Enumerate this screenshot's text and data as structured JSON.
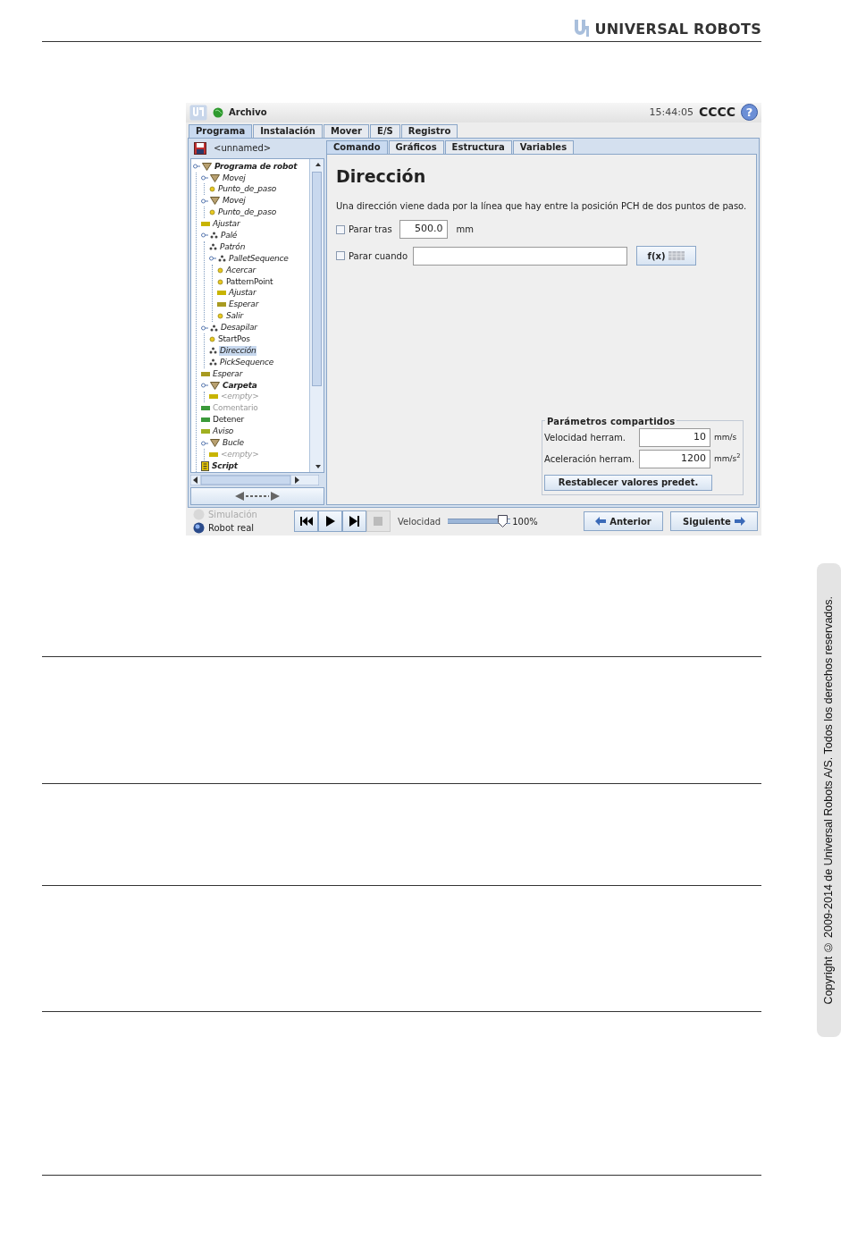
{
  "header": {
    "brand": "UNIVERSAL ROBOTS"
  },
  "app": {
    "title_bar": {
      "menu": "Archivo",
      "time": "15:44:05",
      "user": "CCCC",
      "help": "?"
    },
    "tabs": [
      {
        "label": "Programa",
        "selected": true
      },
      {
        "label": "Instalación",
        "selected": false
      },
      {
        "label": "Mover",
        "selected": false
      },
      {
        "label": "E/S",
        "selected": false
      },
      {
        "label": "Registro",
        "selected": false
      }
    ],
    "program_name": "<unnamed>",
    "tree": [
      {
        "label": "Programa de robot",
        "kind": "folder",
        "bold": true,
        "italic": true,
        "greyed": false,
        "selected": false,
        "children": [
          {
            "label": "Movej",
            "kind": "folder",
            "bold": false,
            "italic": true,
            "greyed": false,
            "selected": false,
            "children": [
              {
                "label": "Punto_de_paso",
                "kind": "waypoint",
                "bold": false,
                "italic": true,
                "greyed": false,
                "selected": false
              }
            ]
          },
          {
            "label": "Movej",
            "kind": "folder",
            "bold": false,
            "italic": true,
            "greyed": false,
            "selected": false,
            "children": [
              {
                "label": "Punto_de_paso",
                "kind": "waypoint",
                "bold": false,
                "italic": true,
                "greyed": false,
                "selected": false
              }
            ]
          },
          {
            "label": "Ajustar",
            "kind": "bar",
            "color": "#c8b400",
            "bold": false,
            "italic": true,
            "greyed": false,
            "selected": false
          },
          {
            "label": "Palé",
            "kind": "pallet",
            "bold": false,
            "italic": true,
            "greyed": false,
            "selected": false,
            "children": [
              {
                "label": "Patrón",
                "kind": "pallet",
                "bold": false,
                "italic": true,
                "greyed": false,
                "selected": false
              },
              {
                "label": "PalletSequence",
                "kind": "pallet",
                "bold": false,
                "italic": true,
                "greyed": false,
                "selected": false,
                "children": [
                  {
                    "label": "Acercar",
                    "kind": "waypoint",
                    "bold": false,
                    "italic": true,
                    "greyed": false,
                    "selected": false
                  },
                  {
                    "label": "PatternPoint",
                    "kind": "waypoint",
                    "bold": false,
                    "italic": false,
                    "greyed": false,
                    "selected": false
                  },
                  {
                    "label": "Ajustar",
                    "kind": "bar",
                    "color": "#c8b400",
                    "bold": false,
                    "italic": true,
                    "greyed": false,
                    "selected": false
                  },
                  {
                    "label": "Esperar",
                    "kind": "bar",
                    "color": "#a89a20",
                    "bold": false,
                    "italic": true,
                    "greyed": false,
                    "selected": false
                  },
                  {
                    "label": "Salir",
                    "kind": "waypoint",
                    "bold": false,
                    "italic": true,
                    "greyed": false,
                    "selected": false
                  }
                ]
              }
            ]
          },
          {
            "label": "Desapilar",
            "kind": "pallet",
            "bold": false,
            "italic": true,
            "greyed": false,
            "selected": false,
            "children": [
              {
                "label": "StartPos",
                "kind": "waypoint",
                "bold": false,
                "italic": false,
                "greyed": false,
                "selected": false
              },
              {
                "label": "Dirección",
                "kind": "pallet",
                "bold": false,
                "italic": true,
                "greyed": false,
                "selected": true
              },
              {
                "label": "PickSequence",
                "kind": "pallet",
                "bold": false,
                "italic": true,
                "greyed": false,
                "selected": false
              }
            ]
          },
          {
            "label": "Esperar",
            "kind": "bar",
            "color": "#a89a20",
            "bold": false,
            "italic": true,
            "greyed": false,
            "selected": false
          },
          {
            "label": "Carpeta",
            "kind": "folder",
            "bold": true,
            "italic": true,
            "greyed": false,
            "selected": false,
            "children": [
              {
                "label": "<empty>",
                "kind": "bar",
                "color": "#c8b400",
                "bold": false,
                "italic": true,
                "greyed": true,
                "selected": false
              }
            ]
          },
          {
            "label": "Comentario",
            "kind": "bar",
            "color": "#3a9a3a",
            "bold": false,
            "italic": false,
            "greyed": true,
            "selected": false
          },
          {
            "label": "Detener",
            "kind": "bar",
            "color": "#3a9a3a",
            "bold": false,
            "italic": false,
            "greyed": false,
            "selected": false
          },
          {
            "label": "Aviso",
            "kind": "bar",
            "color": "#a0b020",
            "bold": false,
            "italic": true,
            "greyed": false,
            "selected": false
          },
          {
            "label": "Bucle",
            "kind": "folder",
            "bold": false,
            "italic": true,
            "greyed": false,
            "selected": false,
            "children": [
              {
                "label": "<empty>",
                "kind": "bar",
                "color": "#c8b400",
                "bold": false,
                "italic": true,
                "greyed": true,
                "selected": false
              }
            ]
          },
          {
            "label": "Script",
            "kind": "script",
            "bold": true,
            "italic": true,
            "greyed": false,
            "selected": false
          }
        ]
      }
    ],
    "subtabs": [
      {
        "label": "Comando",
        "selected": true
      },
      {
        "label": "Gráficos",
        "selected": false
      },
      {
        "label": "Estructura",
        "selected": false
      },
      {
        "label": "Variables",
        "selected": false
      }
    ],
    "panel": {
      "title": "Dirección",
      "description": "Una dirección viene dada por la línea que hay entre la posición PCH de dos puntos de paso.",
      "stop_after": {
        "label": "Parar tras",
        "checked": false,
        "value": "500.0",
        "unit": "mm"
      },
      "stop_when": {
        "label": "Parar cuando",
        "checked": false,
        "button": "f(x)"
      },
      "shared": {
        "legend": "Parámetros compartidos",
        "rows": [
          {
            "label": "Velocidad herram.",
            "value": "10",
            "unit": "mm/s"
          },
          {
            "label": "Aceleración herram.",
            "value": "1200",
            "unit": "mm/s$^{2}$"
          }
        ],
        "button": "Restablecer valores predet."
      }
    },
    "mode": [
      {
        "label": "Simulación",
        "selected": false,
        "disabled": true
      },
      {
        "label": "Robot real",
        "selected": true,
        "disabled": false
      }
    ],
    "speed": {
      "label": "Velocidad",
      "level": 0.95,
      "reading": "100%"
    },
    "nav": {
      "back": "Anterior",
      "next": "Siguiente"
    }
  },
  "copyright": "Copyright © 2009-2014 de Universal Robots A/S. Todos los derechos reservados."
}
